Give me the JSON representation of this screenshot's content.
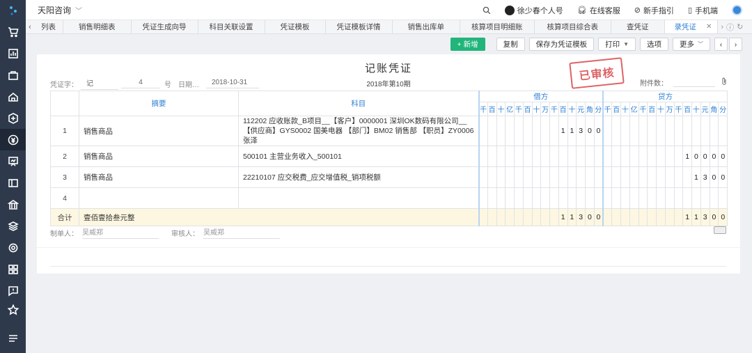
{
  "company": "天阳咨询",
  "top_right": {
    "user": "徐少春个人号",
    "service": "在线客服",
    "guide": "新手指引",
    "mobile": "手机端"
  },
  "tabs": [
    "列表",
    "销售明细表",
    "凭证生成向导",
    "科目关联设置",
    "凭证模板",
    "凭证模板详情",
    "销售出库单",
    "核算项目明细账",
    "核算项目综合表",
    "查凭证",
    "录凭证"
  ],
  "active_tab": "录凭证",
  "toolbar": {
    "add": "+ 新增",
    "copy": "复制",
    "save_template": "保存为凭证模板",
    "print": "打印",
    "options": "选项",
    "more": "更多"
  },
  "voucher": {
    "title": "记账凭证",
    "period": "2018年第10期",
    "stamp": "已审核",
    "word_label": "凭证字：",
    "word_value": "记",
    "number_value": "4",
    "number_label": "号",
    "date_label": "日期…",
    "date_value": "2018-10-31",
    "attach_label": "附件数：",
    "col_summary": "摘要",
    "col_account": "科目",
    "col_debit": "借方",
    "col_credit": "贷方",
    "digit_units": [
      "千",
      "百",
      "十",
      "亿",
      "千",
      "百",
      "十",
      "万",
      "千",
      "百",
      "十",
      "元",
      "角",
      "分"
    ],
    "rows": [
      {
        "no": "1",
        "summary": "销售商品",
        "account": "112202 应收账款_B项目__【客户】0000001 深圳OK数码有限公司__【供应商】GYS0002 国美电器 【部门】BM02 销售部 【职员】ZY0006 张泽",
        "debit": "11300",
        "credit": ""
      },
      {
        "no": "2",
        "summary": "销售商品",
        "account": "500101 主营业务收入_500101",
        "debit": "",
        "credit": "10000"
      },
      {
        "no": "3",
        "summary": "销售商品",
        "account": "22210107 应交税费_应交增值税_销项税额",
        "debit": "",
        "credit": "1300"
      },
      {
        "no": "4",
        "summary": "",
        "account": "",
        "debit": "",
        "credit": ""
      }
    ],
    "total_label": "合计",
    "total_text": "壹佰壹拾叁元整",
    "total_debit": "11300",
    "total_credit": "11300",
    "maker_label": "制单人：",
    "maker": "吴威郑",
    "auditor_label": "审核人：",
    "auditor": "吴威郑"
  }
}
